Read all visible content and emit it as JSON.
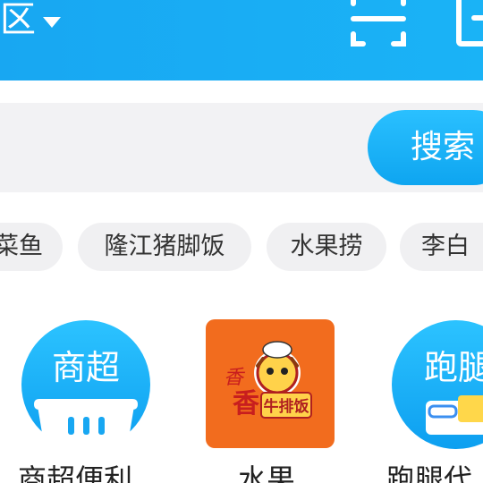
{
  "header": {
    "district_label": "区",
    "background": "#1aaef5"
  },
  "search": {
    "button_label": "搜索"
  },
  "hot_searches": [
    {
      "label": "菜鱼"
    },
    {
      "label": "隆江猪脚饭"
    },
    {
      "label": "水果捞"
    },
    {
      "label": "李白"
    }
  ],
  "categories": [
    {
      "label": "商超便利",
      "icon_text": "商超",
      "icon": "supermarket-basket-icon"
    },
    {
      "label": "水果",
      "icon_text_1": "香",
      "icon_text_2": "牛排饭",
      "icon": "steak-rice-logo"
    },
    {
      "label": "跑腿代",
      "icon_text": "跑腿",
      "icon": "errand-icon"
    }
  ]
}
